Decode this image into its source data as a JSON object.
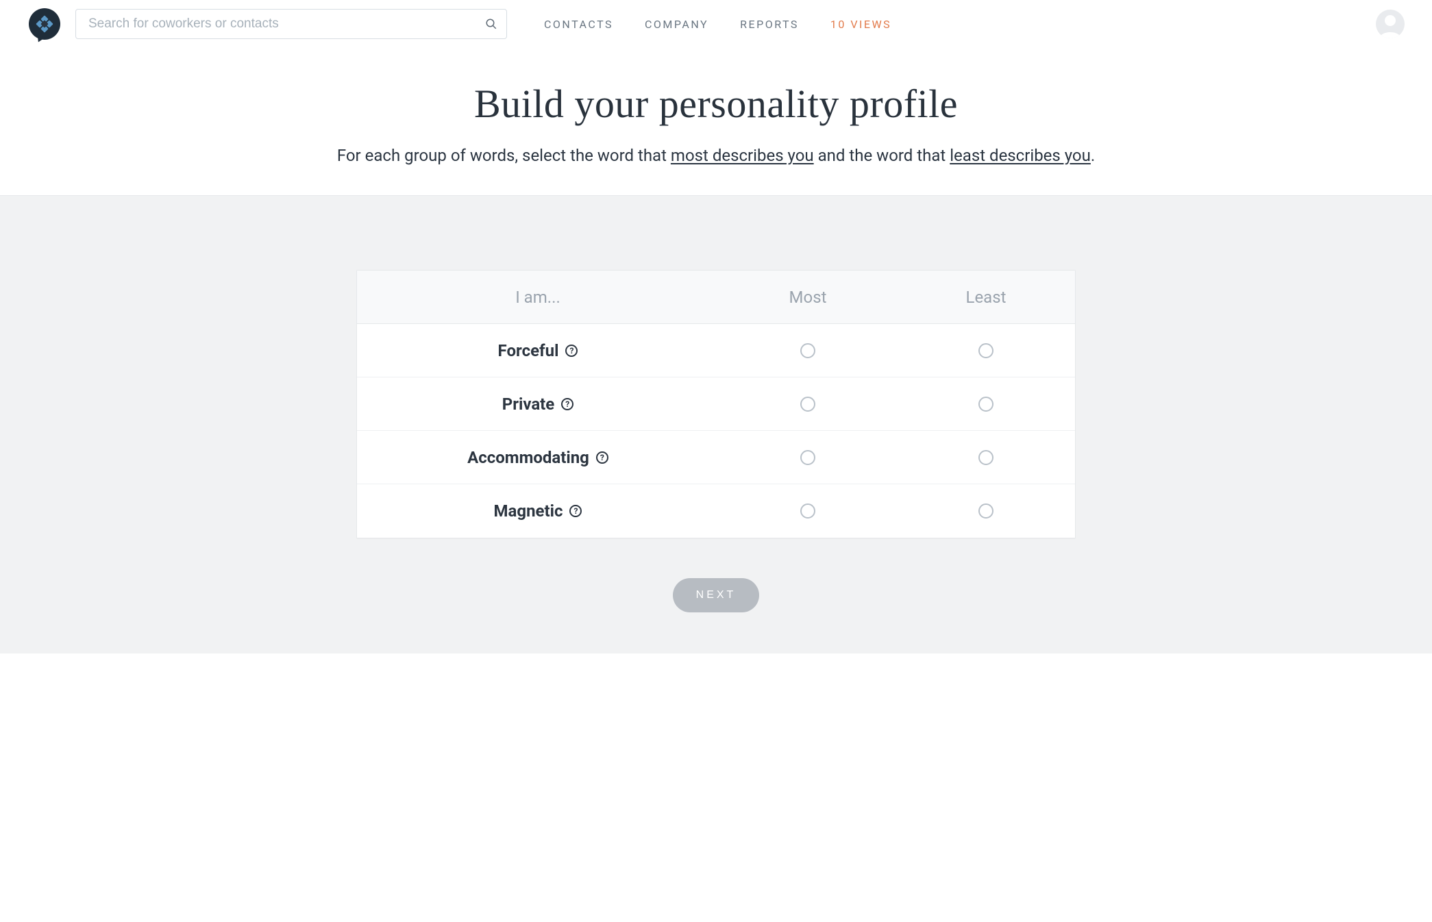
{
  "search": {
    "placeholder": "Search for coworkers or contacts"
  },
  "nav": {
    "contacts": "CONTACTS",
    "company": "COMPANY",
    "reports": "REPORTS",
    "views": "10 VIEWS"
  },
  "hero": {
    "title": "Build your personality profile",
    "sub_1": "For each group of words, select the word that ",
    "sub_most": "most describes you",
    "sub_2": " and the word that ",
    "sub_least": "least describes you",
    "sub_3": "."
  },
  "card": {
    "header": {
      "col1": "I am...",
      "col2": "Most",
      "col3": "Least"
    },
    "rows": [
      {
        "label": "Forceful"
      },
      {
        "label": "Private"
      },
      {
        "label": "Accommodating"
      },
      {
        "label": "Magnetic"
      }
    ]
  },
  "next_label": "NEXT"
}
